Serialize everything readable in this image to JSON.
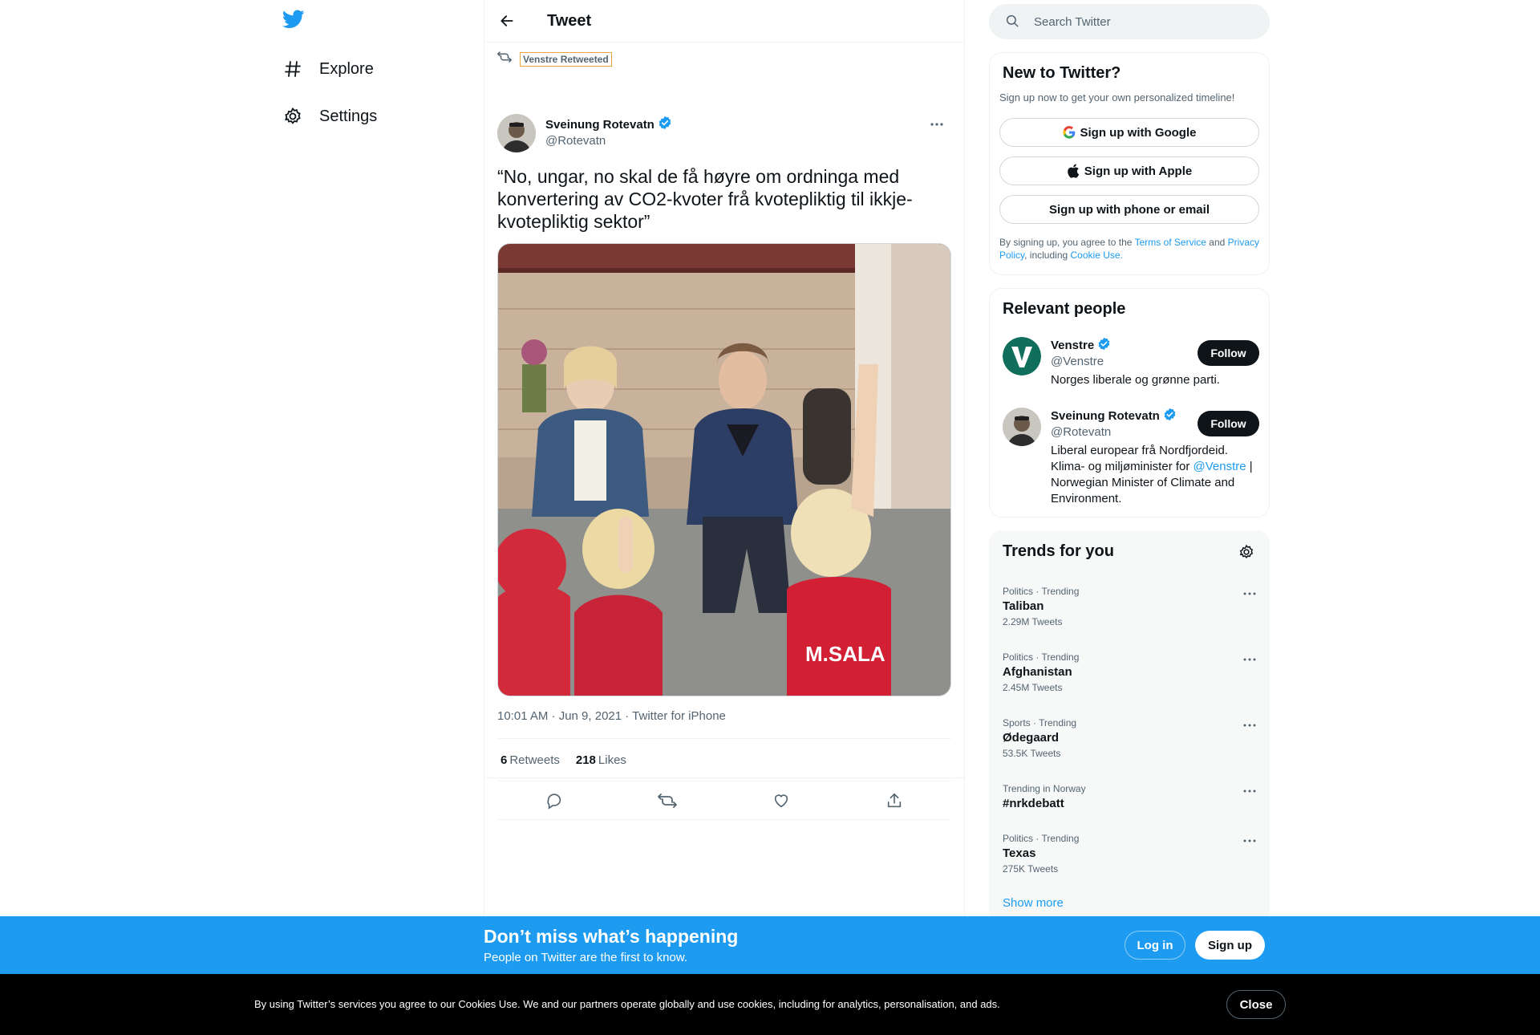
{
  "nav": {
    "items": [
      {
        "label": "Explore",
        "icon": "hashtag-icon"
      },
      {
        "label": "Settings",
        "icon": "gear-icon"
      }
    ]
  },
  "header": {
    "title": "Tweet"
  },
  "tweet": {
    "retweeted_by": "Venstre Retweeted",
    "author_name": "Sveinung Rotevatn",
    "author_handle": "@Rotevatn",
    "text": "“No, ungar, no skal de få høyre om ordninga med konvertering av CO2-kvoter frå kvotepliktig til ikkje-kvotepliktig sektor”",
    "meta": "10:01 AM · Jun 9, 2021 · Twitter for iPhone",
    "retweets_count": "6",
    "retweets_label": "Retweets",
    "likes_count": "218",
    "likes_label": "Likes"
  },
  "search": {
    "placeholder": "Search Twitter"
  },
  "new_to_twitter": {
    "title": "New to Twitter?",
    "subtitle": "Sign up now to get your own personalized timeline!",
    "google_label": "Sign up with Google",
    "apple_label": "Sign up with Apple",
    "phone_label": "Sign up with phone or email",
    "legal_prefix": "By signing up, you agree to the",
    "terms": "Terms of Service",
    "and": "and",
    "privacy": "Privacy Policy",
    "including": ", including",
    "cookie_use": "Cookie Use."
  },
  "relevant_people": {
    "title": "Relevant people",
    "people": [
      {
        "name": "Venstre",
        "handle": "@Venstre",
        "bio": "Norges liberale og grønne parti.",
        "follow_label": "Follow"
      },
      {
        "name": "Sveinung Rotevatn",
        "handle": "@Rotevatn",
        "bio_prefix": "Liberal europear frå Nordfjordeid. Klima- og miljøminister for",
        "bio_mention": "@Venstre",
        "bio_suffix": "| Norwegian Minister of Climate and Environment.",
        "follow_label": "Follow"
      }
    ]
  },
  "trends": {
    "title": "Trends for you",
    "items": [
      {
        "category": "Politics · Trending",
        "name": "Taliban",
        "count": "2.29M Tweets"
      },
      {
        "category": "Politics · Trending",
        "name": "Afghanistan",
        "count": "2.45M Tweets"
      },
      {
        "category": "Sports · Trending",
        "name": "Ødegaard",
        "count": "53.5K Tweets"
      },
      {
        "category": "Trending in Norway",
        "name": "#nrkdebatt",
        "count": ""
      },
      {
        "category": "Politics · Trending",
        "name": "Texas",
        "count": "275K Tweets"
      }
    ],
    "show_more": "Show more"
  },
  "banner": {
    "title": "Don’t miss what’s happening",
    "subtitle": "People on Twitter are the first to know.",
    "login_label": "Log in",
    "signup_label": "Sign up"
  },
  "cookie": {
    "text": "By using Twitter’s services you agree to our Cookies Use. We and our partners operate globally and use cookies, including for analytics, personalisation, and ads.",
    "close_label": "Close"
  },
  "colors": {
    "accent": "#1d9bf0",
    "text": "#0f1419",
    "muted": "#536471",
    "banner": "#1d9bf0",
    "cookie_bg": "#000000"
  }
}
